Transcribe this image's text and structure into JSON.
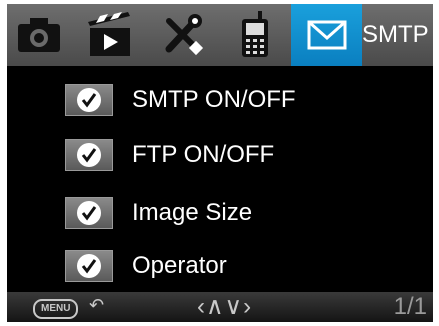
{
  "tabs": [
    {
      "icon": "camera-icon",
      "active": false
    },
    {
      "icon": "video-icon",
      "active": false
    },
    {
      "icon": "tools-icon",
      "active": false
    },
    {
      "icon": "cellular-phone-icon",
      "active": false
    },
    {
      "icon": "mail-icon",
      "active": true
    }
  ],
  "header": {
    "active_tab_label": "SMTP"
  },
  "menu": {
    "items": [
      {
        "label": "SMTP ON/OFF",
        "checked": true
      },
      {
        "label": "FTP ON/OFF",
        "checked": true
      },
      {
        "label": "Image Size",
        "checked": true
      },
      {
        "label": "Operator",
        "checked": true
      }
    ]
  },
  "footer": {
    "menu_button": "MENU",
    "back_icon": "back-arrow-icon",
    "nav_arrows": "‹∧∨›",
    "page_indicator": "1/1"
  },
  "colors": {
    "accent": "#0a8fd0",
    "background": "#000000",
    "text": "#ffffff"
  }
}
